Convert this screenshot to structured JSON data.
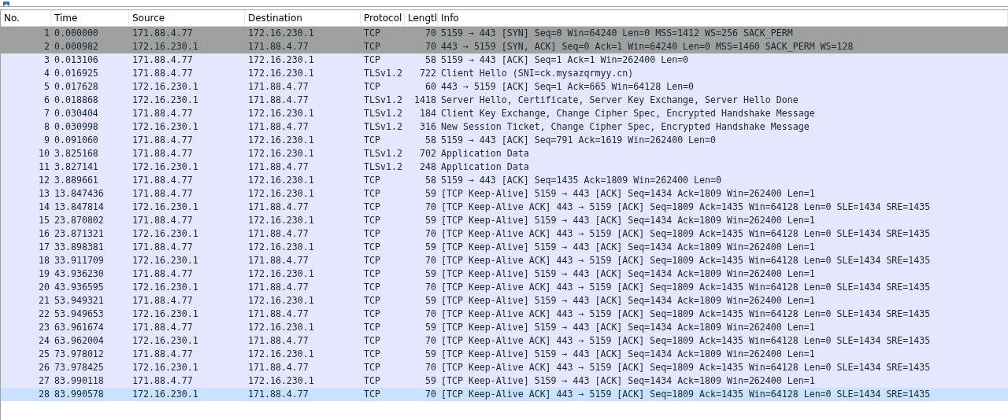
{
  "columns": [
    "No.",
    "Time",
    "Source",
    "Destination",
    "Protocol",
    "Lengtl",
    "Info"
  ],
  "rows": [
    {
      "no": "1",
      "time": "0.000000",
      "source": "171.88.4.77",
      "destination": "172.16.230.1",
      "protocol": "TCP",
      "length": "70",
      "info": "5159 → 443 [SYN] Seq=0 Win=64240 Len=0 MSS=1412 WS=256 SACK_PERM",
      "color": "#a0a0a0",
      "selected": false
    },
    {
      "no": "2",
      "time": "0.000982",
      "source": "172.16.230.1",
      "destination": "171.88.4.77",
      "protocol": "TCP",
      "length": "70",
      "info": "443 → 5159 [SYN, ACK] Seq=0 Ack=1 Win=64240 Len=0 MSS=1460 SACK_PERM WS=128",
      "color": "#a0a0a0",
      "selected": false
    },
    {
      "no": "3",
      "time": "0.013106",
      "source": "171.88.4.77",
      "destination": "172.16.230.1",
      "protocol": "TCP",
      "length": "58",
      "info": "5159 → 443 [ACK] Seq=1 Ack=1 Win=262400 Len=0",
      "color": "#e7e6ff",
      "selected": false
    },
    {
      "no": "4",
      "time": "0.016925",
      "source": "171.88.4.77",
      "destination": "172.16.230.1",
      "protocol": "TLSv1.2",
      "length": "722",
      "info": "Client Hello (SNI=ck.mysazqrmyy.cn)",
      "color": "#e7e6ff",
      "selected": false
    },
    {
      "no": "5",
      "time": "0.017628",
      "source": "172.16.230.1",
      "destination": "171.88.4.77",
      "protocol": "TCP",
      "length": "60",
      "info": "443 → 5159 [ACK] Seq=1 Ack=665 Win=64128 Len=0",
      "color": "#e7e6ff",
      "selected": false
    },
    {
      "no": "6",
      "time": "0.018868",
      "source": "172.16.230.1",
      "destination": "171.88.4.77",
      "protocol": "TLSv1.2",
      "length": "1418",
      "info": "Server Hello, Certificate, Server Key Exchange, Server Hello Done",
      "color": "#e7e6ff",
      "selected": false
    },
    {
      "no": "7",
      "time": "0.030404",
      "source": "171.88.4.77",
      "destination": "172.16.230.1",
      "protocol": "TLSv1.2",
      "length": "184",
      "info": "Client Key Exchange, Change Cipher Spec, Encrypted Handshake Message",
      "color": "#e7e6ff",
      "selected": false
    },
    {
      "no": "8",
      "time": "0.030998",
      "source": "172.16.230.1",
      "destination": "171.88.4.77",
      "protocol": "TLSv1.2",
      "length": "316",
      "info": "New Session Ticket, Change Cipher Spec, Encrypted Handshake Message",
      "color": "#e7e6ff",
      "selected": false
    },
    {
      "no": "9",
      "time": "0.091060",
      "source": "171.88.4.77",
      "destination": "172.16.230.1",
      "protocol": "TCP",
      "length": "58",
      "info": "5159 → 443 [ACK] Seq=791 Ack=1619 Win=262400 Len=0",
      "color": "#e7e6ff",
      "selected": false
    },
    {
      "no": "10",
      "time": "3.825168",
      "source": "171.88.4.77",
      "destination": "172.16.230.1",
      "protocol": "TLSv1.2",
      "length": "702",
      "info": "Application Data",
      "color": "#e7e6ff",
      "selected": false
    },
    {
      "no": "11",
      "time": "3.827141",
      "source": "172.16.230.1",
      "destination": "171.88.4.77",
      "protocol": "TLSv1.2",
      "length": "248",
      "info": "Application Data",
      "color": "#e7e6ff",
      "selected": false
    },
    {
      "no": "12",
      "time": "3.889661",
      "source": "171.88.4.77",
      "destination": "172.16.230.1",
      "protocol": "TCP",
      "length": "58",
      "info": "5159 → 443 [ACK] Seq=1435 Ack=1809 Win=262400 Len=0",
      "color": "#e7e6ff",
      "selected": false
    },
    {
      "no": "13",
      "time": "13.847436",
      "source": "171.88.4.77",
      "destination": "172.16.230.1",
      "protocol": "TCP",
      "length": "59",
      "info": "[TCP Keep-Alive] 5159 → 443 [ACK] Seq=1434 Ack=1809 Win=262400 Len=1",
      "color": "#e7e6ff",
      "selected": false
    },
    {
      "no": "14",
      "time": "13.847814",
      "source": "172.16.230.1",
      "destination": "171.88.4.77",
      "protocol": "TCP",
      "length": "70",
      "info": "[TCP Keep-Alive ACK] 443 → 5159 [ACK] Seq=1809 Ack=1435 Win=64128 Len=0 SLE=1434 SRE=1435",
      "color": "#e7e6ff",
      "selected": false
    },
    {
      "no": "15",
      "time": "23.870802",
      "source": "171.88.4.77",
      "destination": "172.16.230.1",
      "protocol": "TCP",
      "length": "59",
      "info": "[TCP Keep-Alive] 5159 → 443 [ACK] Seq=1434 Ack=1809 Win=262400 Len=1",
      "color": "#e7e6ff",
      "selected": false
    },
    {
      "no": "16",
      "time": "23.871321",
      "source": "172.16.230.1",
      "destination": "171.88.4.77",
      "protocol": "TCP",
      "length": "70",
      "info": "[TCP Keep-Alive ACK] 443 → 5159 [ACK] Seq=1809 Ack=1435 Win=64128 Len=0 SLE=1434 SRE=1435",
      "color": "#e7e6ff",
      "selected": false
    },
    {
      "no": "17",
      "time": "33.898381",
      "source": "171.88.4.77",
      "destination": "172.16.230.1",
      "protocol": "TCP",
      "length": "59",
      "info": "[TCP Keep-Alive] 5159 → 443 [ACK] Seq=1434 Ack=1809 Win=262400 Len=1",
      "color": "#e7e6ff",
      "selected": false
    },
    {
      "no": "18",
      "time": "33.911709",
      "source": "172.16.230.1",
      "destination": "171.88.4.77",
      "protocol": "TCP",
      "length": "70",
      "info": "[TCP Keep-Alive ACK] 443 → 5159 [ACK] Seq=1809 Ack=1435 Win=64128 Len=0 SLE=1434 SRE=1435",
      "color": "#e7e6ff",
      "selected": false
    },
    {
      "no": "19",
      "time": "43.936230",
      "source": "171.88.4.77",
      "destination": "172.16.230.1",
      "protocol": "TCP",
      "length": "59",
      "info": "[TCP Keep-Alive] 5159 → 443 [ACK] Seq=1434 Ack=1809 Win=262400 Len=1",
      "color": "#e7e6ff",
      "selected": false
    },
    {
      "no": "20",
      "time": "43.936595",
      "source": "172.16.230.1",
      "destination": "171.88.4.77",
      "protocol": "TCP",
      "length": "70",
      "info": "[TCP Keep-Alive ACK] 443 → 5159 [ACK] Seq=1809 Ack=1435 Win=64128 Len=0 SLE=1434 SRE=1435",
      "color": "#e7e6ff",
      "selected": false
    },
    {
      "no": "21",
      "time": "53.949321",
      "source": "171.88.4.77",
      "destination": "172.16.230.1",
      "protocol": "TCP",
      "length": "59",
      "info": "[TCP Keep-Alive] 5159 → 443 [ACK] Seq=1434 Ack=1809 Win=262400 Len=1",
      "color": "#e7e6ff",
      "selected": false
    },
    {
      "no": "22",
      "time": "53.949653",
      "source": "172.16.230.1",
      "destination": "171.88.4.77",
      "protocol": "TCP",
      "length": "70",
      "info": "[TCP Keep-Alive ACK] 443 → 5159 [ACK] Seq=1809 Ack=1435 Win=64128 Len=0 SLE=1434 SRE=1435",
      "color": "#e7e6ff",
      "selected": false
    },
    {
      "no": "23",
      "time": "63.961674",
      "source": "171.88.4.77",
      "destination": "172.16.230.1",
      "protocol": "TCP",
      "length": "59",
      "info": "[TCP Keep-Alive] 5159 → 443 [ACK] Seq=1434 Ack=1809 Win=262400 Len=1",
      "color": "#e7e6ff",
      "selected": false
    },
    {
      "no": "24",
      "time": "63.962004",
      "source": "172.16.230.1",
      "destination": "171.88.4.77",
      "protocol": "TCP",
      "length": "70",
      "info": "[TCP Keep-Alive ACK] 443 → 5159 [ACK] Seq=1809 Ack=1435 Win=64128 Len=0 SLE=1434 SRE=1435",
      "color": "#e7e6ff",
      "selected": false
    },
    {
      "no": "25",
      "time": "73.978012",
      "source": "171.88.4.77",
      "destination": "172.16.230.1",
      "protocol": "TCP",
      "length": "59",
      "info": "[TCP Keep-Alive] 5159 → 443 [ACK] Seq=1434 Ack=1809 Win=262400 Len=1",
      "color": "#e7e6ff",
      "selected": false
    },
    {
      "no": "26",
      "time": "73.978425",
      "source": "172.16.230.1",
      "destination": "171.88.4.77",
      "protocol": "TCP",
      "length": "70",
      "info": "[TCP Keep-Alive ACK] 443 → 5159 [ACK] Seq=1809 Ack=1435 Win=64128 Len=0 SLE=1434 SRE=1435",
      "color": "#e7e6ff",
      "selected": false
    },
    {
      "no": "27",
      "time": "83.990118",
      "source": "171.88.4.77",
      "destination": "172.16.230.1",
      "protocol": "TCP",
      "length": "59",
      "info": "[TCP Keep-Alive] 5159 → 443 [ACK] Seq=1434 Ack=1809 Win=262400 Len=1",
      "color": "#e7e6ff",
      "selected": false
    },
    {
      "no": "28",
      "time": "83.990578",
      "source": "172.16.230.1",
      "destination": "171.88.4.77",
      "protocol": "TCP",
      "length": "70",
      "info": "[TCP Keep-Alive ACK] 443 → 5159 [ACK] Seq=1809 Ack=1435 Win=64128 Len=0 SLE=1434 SRE=1435",
      "selected": true
    }
  ]
}
